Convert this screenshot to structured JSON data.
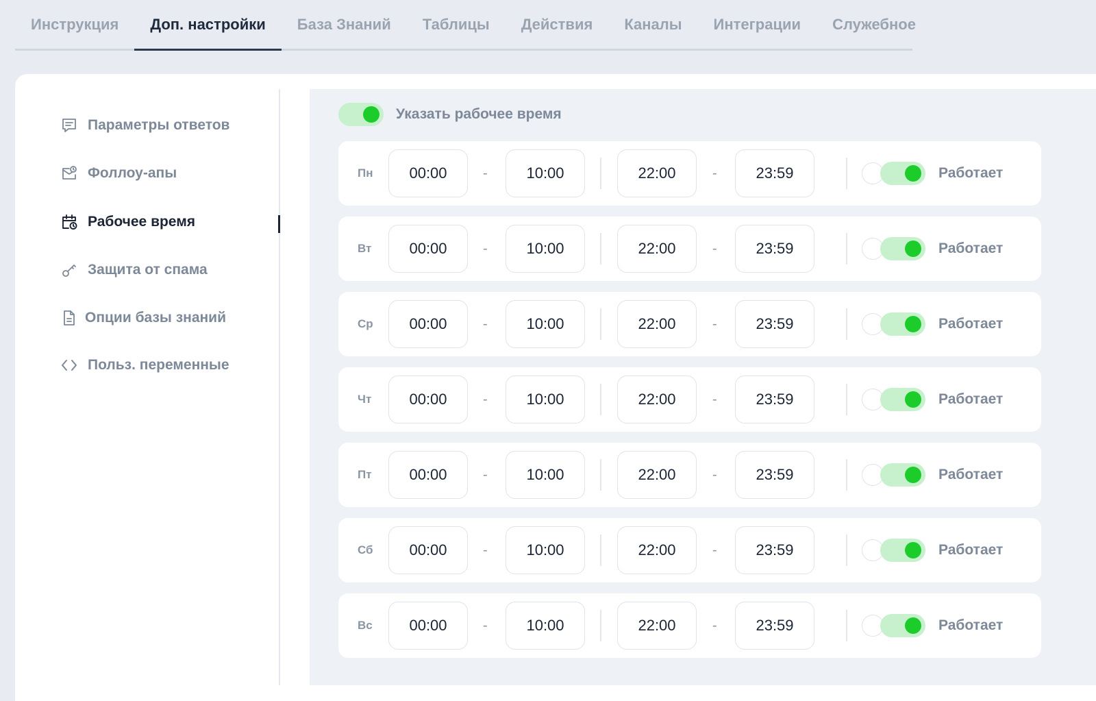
{
  "tabs": [
    {
      "label": "Инструкция",
      "active": false
    },
    {
      "label": "Доп. настройки",
      "active": true
    },
    {
      "label": "База Знаний",
      "active": false
    },
    {
      "label": "Таблицы",
      "active": false
    },
    {
      "label": "Действия",
      "active": false
    },
    {
      "label": "Каналы",
      "active": false
    },
    {
      "label": "Интеграции",
      "active": false
    },
    {
      "label": "Служебное",
      "active": false
    }
  ],
  "sidebar": {
    "items": [
      {
        "label": "Параметры ответов",
        "icon": "message-lines-icon",
        "active": false
      },
      {
        "label": "Фоллоу-апы",
        "icon": "mail-clock-icon",
        "active": false
      },
      {
        "label": "Рабочее время",
        "icon": "calendar-clock-icon",
        "active": true
      },
      {
        "label": "Защита от спама",
        "icon": "key-icon",
        "active": false
      },
      {
        "label": "Опции базы знаний",
        "icon": "document-icon",
        "active": false
      },
      {
        "label": "Польз. переменные",
        "icon": "code-brackets-icon",
        "active": false
      }
    ]
  },
  "working_hours": {
    "master_label": "Указать рабочее время",
    "master_enabled": true,
    "days": [
      {
        "day": "Пн",
        "from1": "00:00",
        "to1": "10:00",
        "from2": "22:00",
        "to2": "23:59",
        "status": "Работает",
        "enabled": true
      },
      {
        "day": "Вт",
        "from1": "00:00",
        "to1": "10:00",
        "from2": "22:00",
        "to2": "23:59",
        "status": "Работает",
        "enabled": true
      },
      {
        "day": "Ср",
        "from1": "00:00",
        "to1": "10:00",
        "from2": "22:00",
        "to2": "23:59",
        "status": "Работает",
        "enabled": true
      },
      {
        "day": "Чт",
        "from1": "00:00",
        "to1": "10:00",
        "from2": "22:00",
        "to2": "23:59",
        "status": "Работает",
        "enabled": true
      },
      {
        "day": "Пт",
        "from1": "00:00",
        "to1": "10:00",
        "from2": "22:00",
        "to2": "23:59",
        "status": "Работает",
        "enabled": true
      },
      {
        "day": "Сб",
        "from1": "00:00",
        "to1": "10:00",
        "from2": "22:00",
        "to2": "23:59",
        "status": "Работает",
        "enabled": true
      },
      {
        "day": "Вс",
        "from1": "00:00",
        "to1": "10:00",
        "from2": "22:00",
        "to2": "23:59",
        "status": "Работает",
        "enabled": true
      }
    ]
  },
  "colors": {
    "accent_green": "#1ccc2b",
    "switch_track": "#c7f0cd",
    "text_dark": "#1b2536",
    "text_muted": "#7d8898"
  }
}
